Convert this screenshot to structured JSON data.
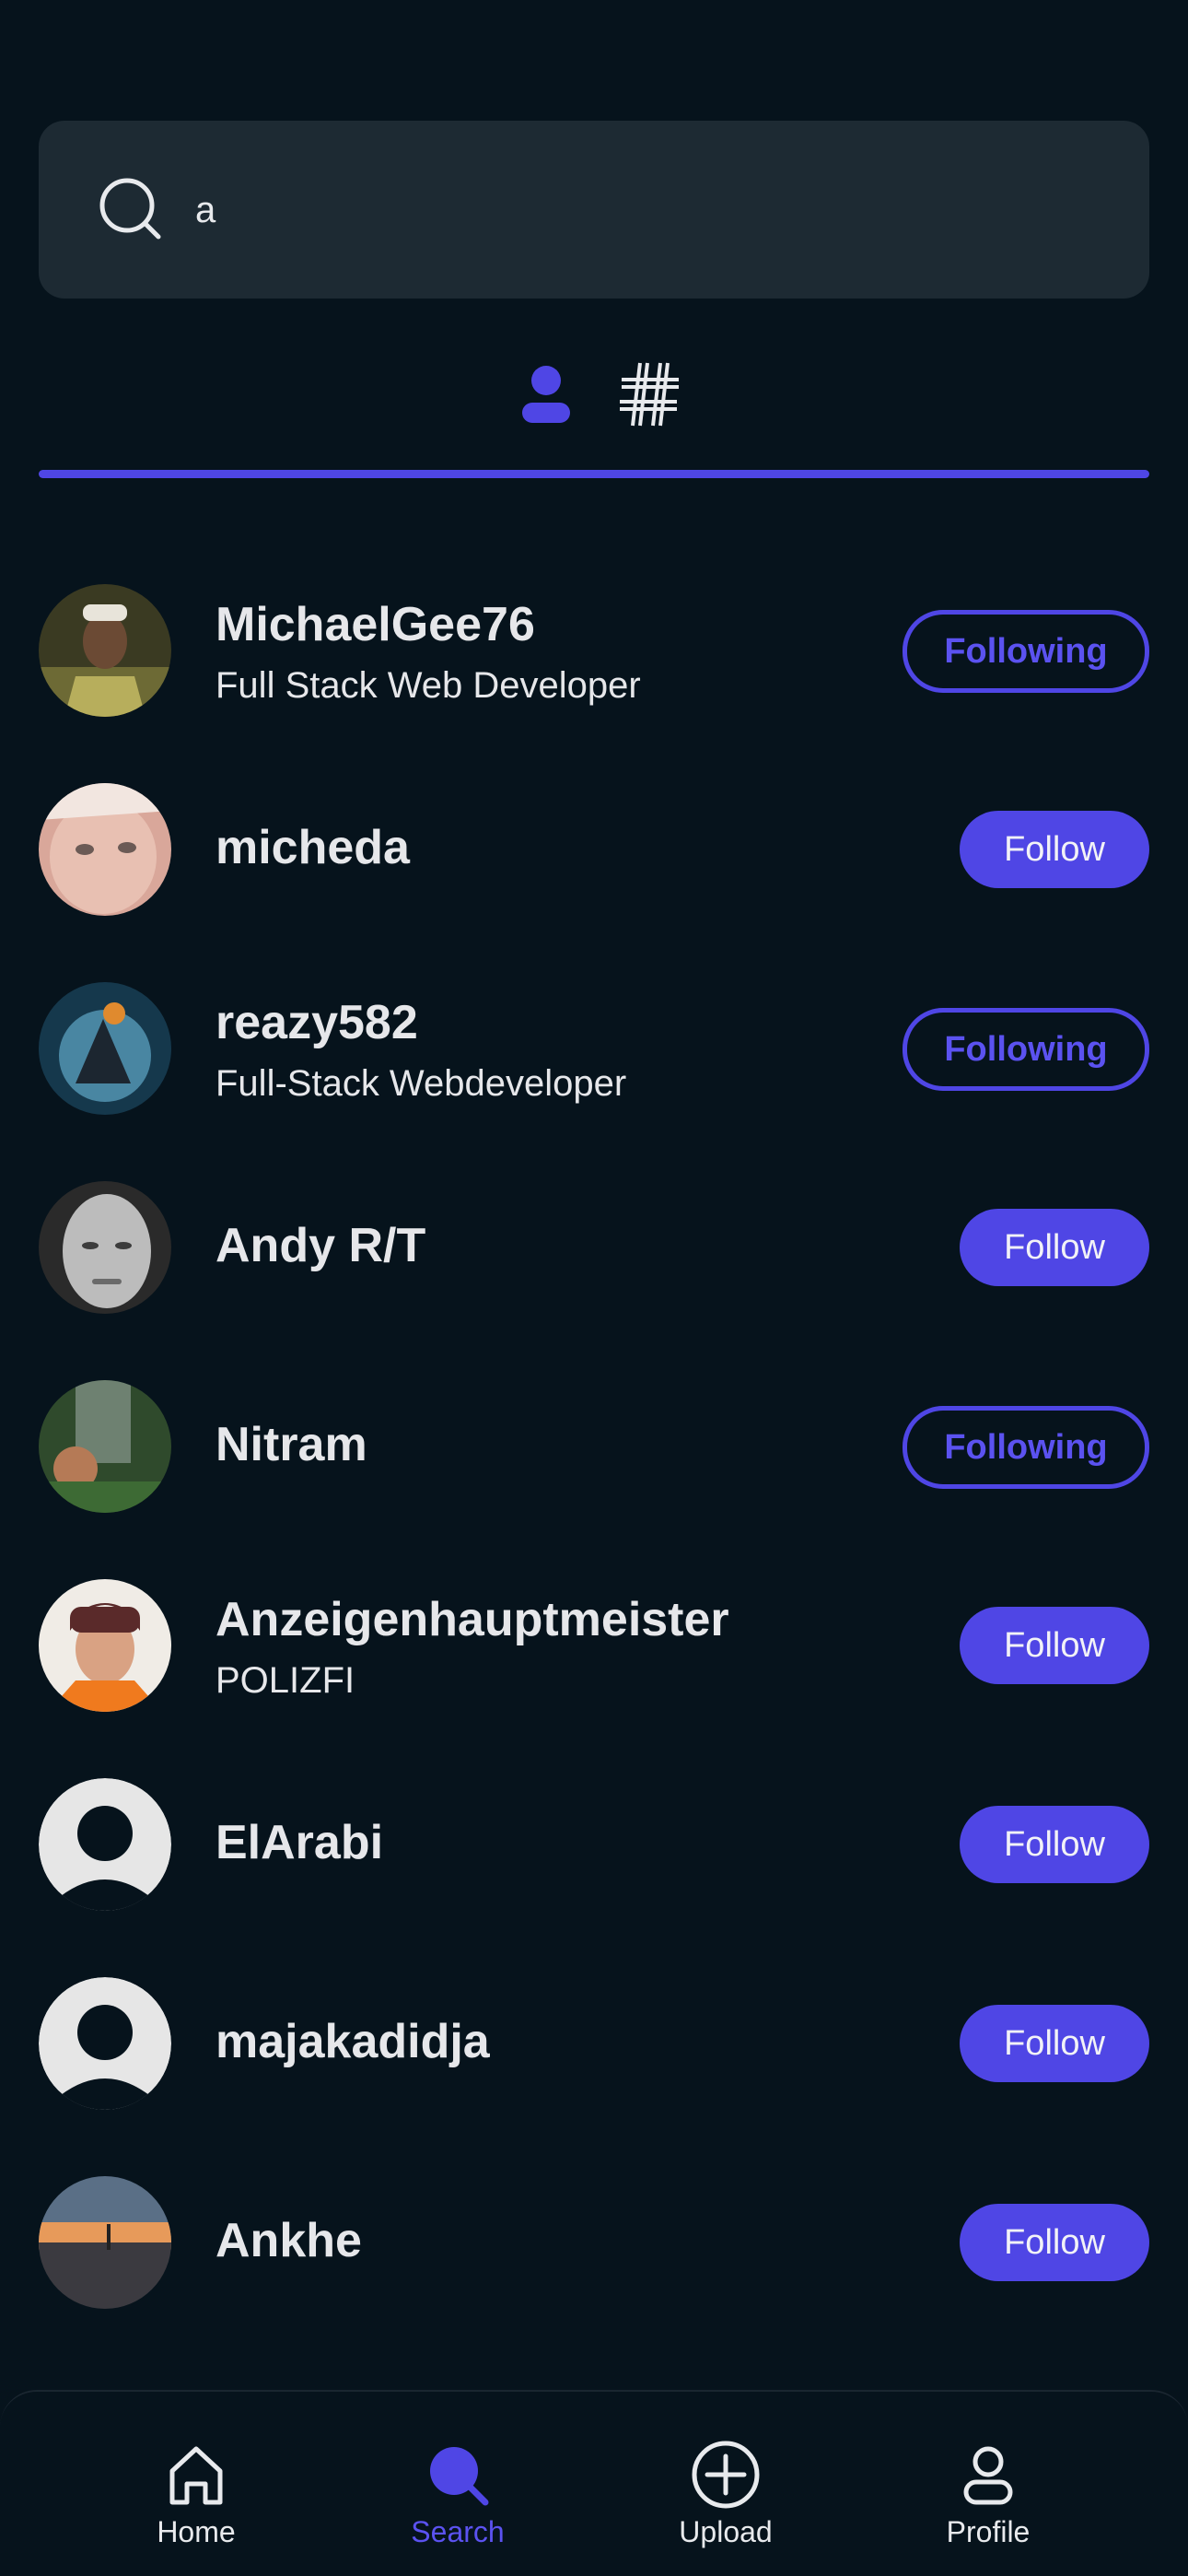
{
  "search": {
    "value": "a",
    "icon": "search-icon"
  },
  "tabs": [
    {
      "icon": "person-icon",
      "active": true
    },
    {
      "icon": "hashtag-icon",
      "active": false
    }
  ],
  "colors": {
    "accent": "#4f46e5",
    "background": "#06131c",
    "search_bg": "#1d2a33"
  },
  "results": [
    {
      "name": "MichaelGee76",
      "bio": "Full Stack Web Developer",
      "button": "Following"
    },
    {
      "name": "micheda",
      "bio": "",
      "button": "Follow"
    },
    {
      "name": "reazy582",
      "bio": "Full-Stack Webdeveloper",
      "button": "Following"
    },
    {
      "name": "Andy R/T",
      "bio": "",
      "button": "Follow"
    },
    {
      "name": "Nitram",
      "bio": "",
      "button": "Following"
    },
    {
      "name": "Anzeigenhauptmeister",
      "bio": "POLIZFI",
      "button": "Follow"
    },
    {
      "name": "ElArabi",
      "bio": "",
      "button": "Follow"
    },
    {
      "name": "majakadidja",
      "bio": "",
      "button": "Follow"
    },
    {
      "name": "Ankhe",
      "bio": "",
      "button": "Follow"
    }
  ],
  "nav": {
    "home": "Home",
    "search": "Search",
    "upload": "Upload",
    "profile": "Profile"
  }
}
